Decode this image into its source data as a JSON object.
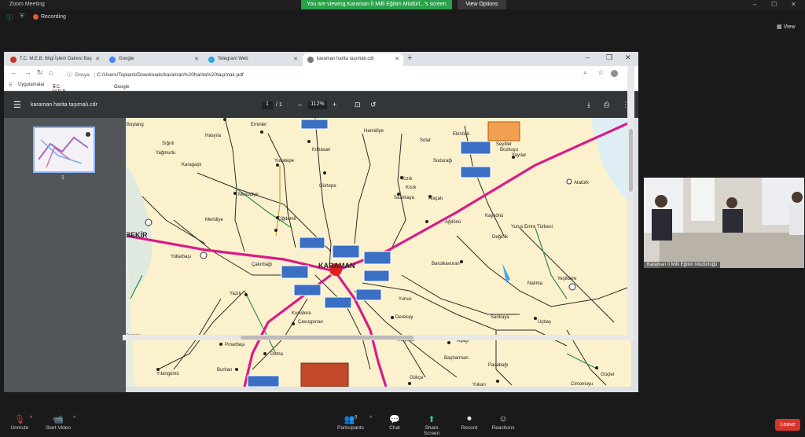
{
  "zoom": {
    "app_title": "Zoom Meeting",
    "recording_label": "Recording",
    "share_banner": "You are viewing Karaman İl Milli Eğitim Müdürl...'s screen",
    "view_options": "View Options",
    "view_button": "View",
    "participant_name": "Karaman İl Milli Eğitim Müdürlüğü",
    "toolbar": {
      "unmute": "Unmute",
      "start_video": "Start Video",
      "participants": "Participants",
      "participants_count": "9",
      "chat": "Chat",
      "share_screen": "Share Screen",
      "record": "Record",
      "reactions": "Reactions",
      "leave": "Leave"
    }
  },
  "browser": {
    "tabs": [
      {
        "label": "T.C. M.E.B. Bilgi İşlem Dairesi Baş",
        "color": "#c0392b"
      },
      {
        "label": "Google",
        "color": "#4285f4"
      },
      {
        "label": "Telegram Web",
        "color": "#2ca5e0"
      },
      {
        "label": "karaman harita taşımalı.cdr",
        "color": "#555555"
      }
    ],
    "url_label": "Dosya",
    "url": "C:/Users/Toplanti/Downloads/karaman%20harita%20taşımalı.pdf",
    "bookmarks": [
      "Uygulamalar",
      "T.C. M.E.B. Bilgi İşle...",
      "Google"
    ]
  },
  "pdf": {
    "filename": "karaman harita taşımalı.cdr",
    "page_current": "1",
    "page_total": "/ 1",
    "zoom": "112%",
    "thumbnail_number": "1"
  },
  "map": {
    "labels": [
      "Eminler",
      "Hamidiye",
      "Ekinözü",
      "Solar",
      "Kılbasan",
      "Sudurağı",
      "Yeşildere",
      "Yağmurlu",
      "Karagaşlı",
      "Yuvatepe",
      "Görtepe",
      "Atatürk",
      "Mesudiye",
      "Kızık",
      "Sazlıkaya",
      "Alaçatı",
      "Çiğdemli",
      "Kaysönü",
      "Ağılönü",
      "Yurus Emre Türbesi",
      "Değirlik",
      "ABEKİR",
      "Yollarbaşı",
      "Çakırbağı",
      "KARAMAN",
      "Barutkavuran",
      "Nalıma",
      "Yazılı",
      "Çavuşpınarı",
      "Kurudere",
      "Yunus",
      "Derekay",
      "Sarıkaya",
      "Uçbaş",
      "Taşkale",
      "Yedipınar",
      "Aşağı",
      "Başharman",
      "Pınarbaşı",
      "Burhan",
      "Duma",
      "Pasabağı",
      "Gökçe",
      "Yukarı",
      "Yılangümü",
      "Güçler",
      "Cimoniuyu",
      "Bozkuyu",
      "Yayılar",
      "Seyitler",
      "Sığırlı",
      "Hasyıla",
      "Boylang",
      "Meridiye",
      "Kısık"
    ],
    "colors": {
      "primary_road": "#d81b8a",
      "route": "#2c2c2c",
      "district_route": "#2e8b57",
      "city_marker": "#e02020",
      "lake": "#4da6e6"
    }
  }
}
